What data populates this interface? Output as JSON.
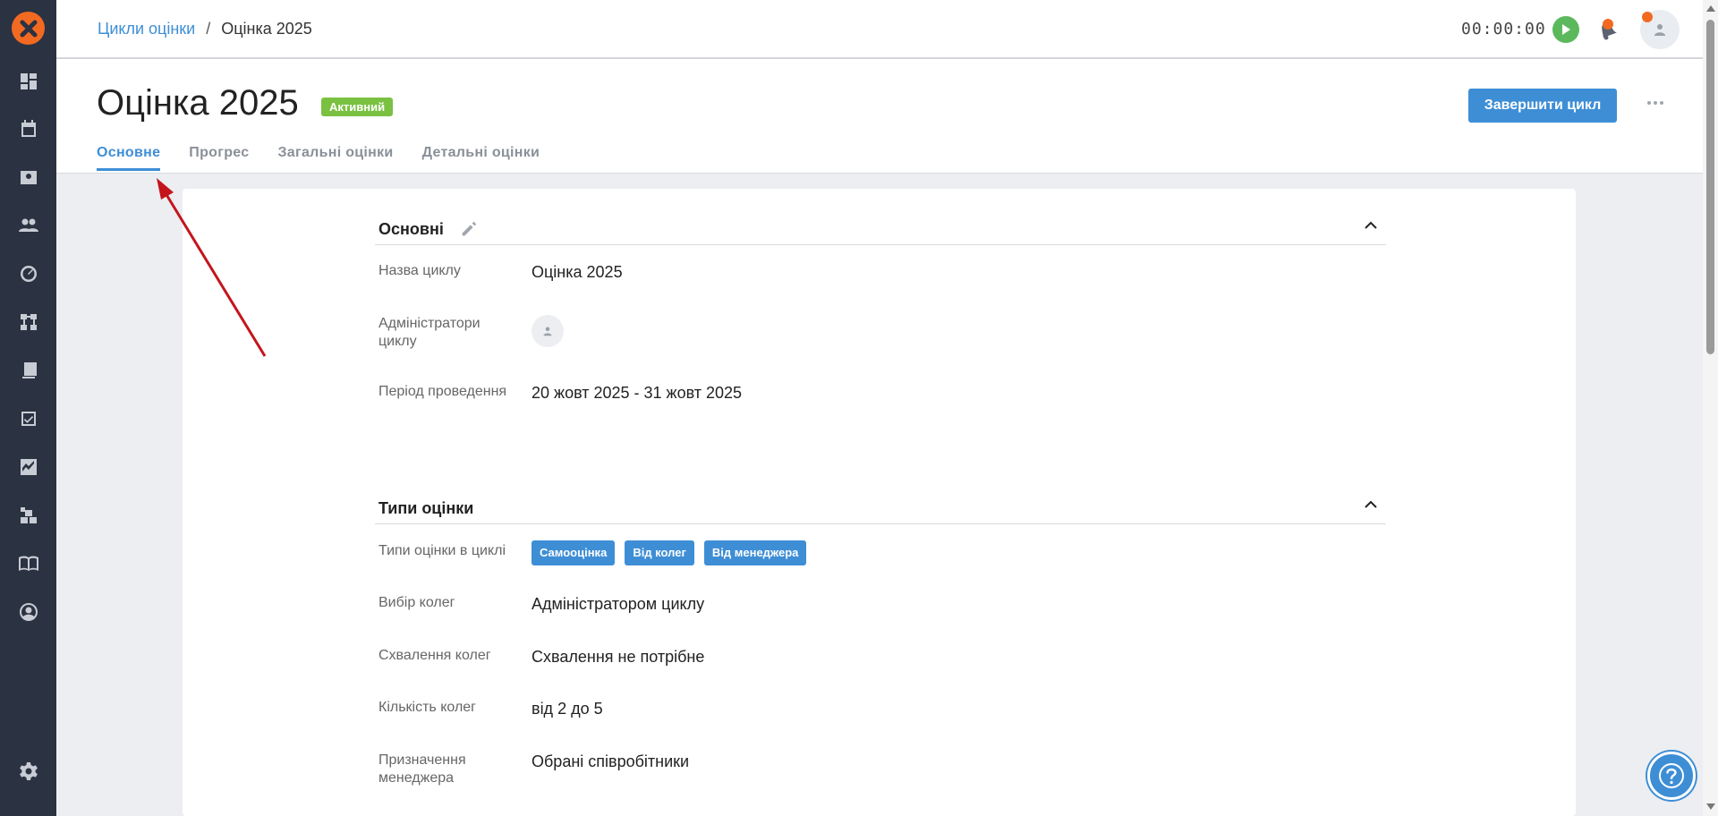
{
  "breadcrumb": {
    "parent": "Цикли оцінки",
    "separator": "/",
    "current": "Оцінка 2025"
  },
  "header": {
    "timer": "00:00:00"
  },
  "page": {
    "title": "Оцінка 2025",
    "status": "Активний",
    "finish_button": "Завершити цикл"
  },
  "tabs": [
    {
      "label": "Основне",
      "active": true
    },
    {
      "label": "Прогрес",
      "active": false
    },
    {
      "label": "Загальні оцінки",
      "active": false
    },
    {
      "label": "Детальні оцінки",
      "active": false
    }
  ],
  "basics": {
    "title": "Основні",
    "rows": [
      {
        "label": "Назва циклу",
        "value": "Оцінка 2025"
      },
      {
        "label": "Адміністратори циклу",
        "value": ""
      },
      {
        "label": "Період проведення",
        "value": "20 жовт 2025 - 31 жовт 2025"
      }
    ]
  },
  "types": {
    "title": "Типи оцінки",
    "types_label": "Типи оцінки в циклі",
    "chips": [
      "Самооцінка",
      "Від колег",
      "Від менеджера"
    ],
    "rows": [
      {
        "label": "Вибір колег",
        "value": "Адміністратором циклу"
      },
      {
        "label": "Схвалення колег",
        "value": "Схвалення не потрібне"
      },
      {
        "label": "Кількість колег",
        "value": "від 2 до 5"
      },
      {
        "label": "Призначення менеджера",
        "value": "Обрані співробітники"
      }
    ]
  },
  "colors": {
    "accent": "#3e8ed6",
    "sidebar": "#2b3241",
    "brand": "#f26a21",
    "status_active": "#7ac142",
    "annotation_arrow": "#c4151c"
  },
  "icons": {
    "sidebar": [
      "dashboard-icon",
      "calendar-icon",
      "contacts-icon",
      "people-icon",
      "speedometer-icon",
      "org-structure-icon",
      "library-icon",
      "checklist-icon",
      "chart-icon",
      "blocks-icon",
      "book-icon",
      "profile-icon",
      "settings-icon"
    ]
  }
}
